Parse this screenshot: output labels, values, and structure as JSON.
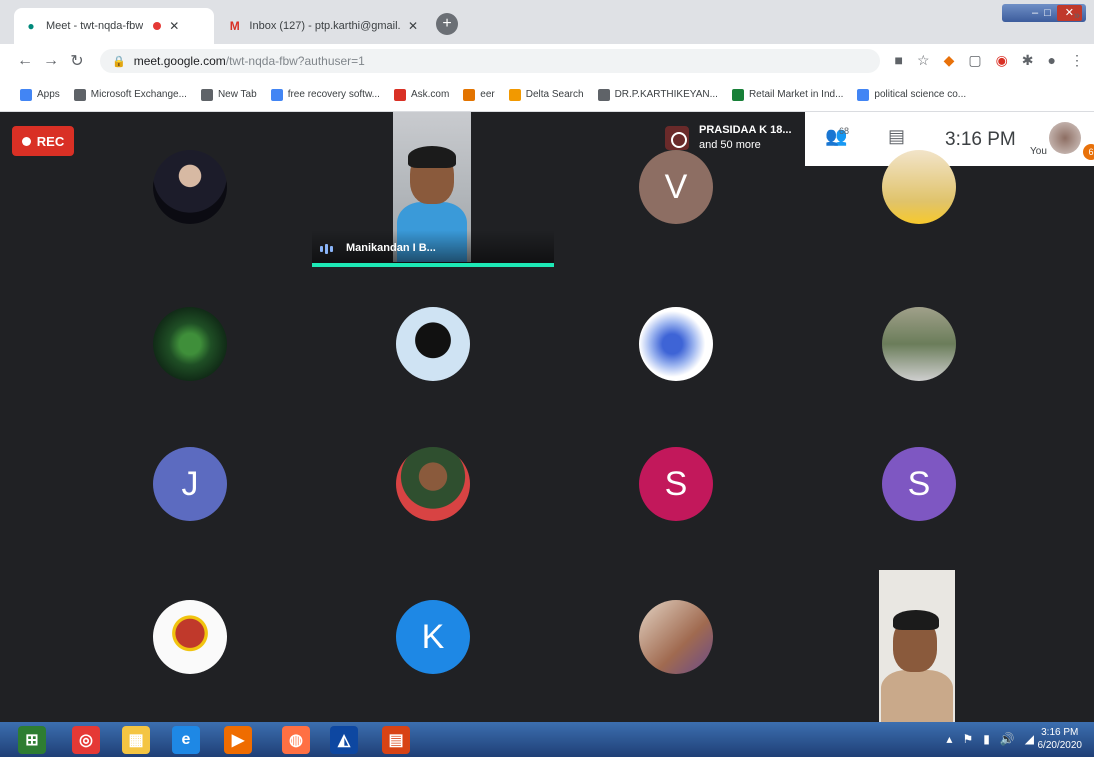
{
  "browser": {
    "tabs": [
      {
        "title": "Meet - twt-nqda-fbw",
        "active": true,
        "icon": "meet-icon",
        "recording": true
      },
      {
        "title": "Inbox (127) - ptp.karthi@gmail...",
        "active": false,
        "icon": "gmail-icon"
      }
    ],
    "new_tab": "+",
    "url_host": "meet.google.com",
    "url_path": "/twt-nqda-fbw?authuser=1",
    "bookmarks": [
      {
        "label": "Apps",
        "icon": "apps-icon",
        "color": "#4285f4"
      },
      {
        "label": "Microsoft Exchange...",
        "icon": "globe-icon",
        "color": "#5f6368"
      },
      {
        "label": "New Tab",
        "icon": "globe-icon",
        "color": "#5f6368"
      },
      {
        "label": "free recovery softw...",
        "icon": "google-icon",
        "color": "#4285f4"
      },
      {
        "label": "Ask.com",
        "icon": "ask-icon",
        "color": "#d93025"
      },
      {
        "label": "eer",
        "icon": "bookmark-icon",
        "color": "#e37400"
      },
      {
        "label": "Delta Search",
        "icon": "delta-icon",
        "color": "#f29900"
      },
      {
        "label": "DR.P.KARTHIKEYAN...",
        "icon": "globe-icon",
        "color": "#5f6368"
      },
      {
        "label": "Retail Market in Ind...",
        "icon": "bookmark-icon",
        "color": "#188038"
      },
      {
        "label": "political science co...",
        "icon": "google-icon",
        "color": "#4285f4"
      }
    ],
    "more_bookmarks": "»"
  },
  "meet": {
    "rec_label": "REC",
    "speaker_name": "Manikandan I B...",
    "presenter": {
      "name": "PRASIDAA K 18...",
      "more": "and 50 more"
    },
    "people_count": "68",
    "time": "3:16 PM",
    "you_label": "You",
    "notification_count": "6",
    "participants": [
      {
        "kind": "photo",
        "name": "participant-photo-1",
        "bg": "radial-gradient(circle at 50% 35%, #d7b9a3 0 18%, #1c1c2a 19% 60%, #0b0b12 61%)"
      },
      {
        "kind": "letter",
        "letter": "V",
        "color": "#8d6e63"
      },
      {
        "kind": "photo",
        "name": "participant-photo-2",
        "bg": "linear-gradient(#f2e4c9, #e0c36a 70%, #f7c92c)"
      },
      {
        "kind": "photo",
        "name": "participant-photo-3",
        "bg": "radial-gradient(circle, #3f8f3a 0 20%, #1f4f25 40%, #0c1f12 80%)"
      },
      {
        "kind": "photo",
        "name": "participant-photo-4",
        "bg": "radial-gradient(circle at 50% 45%, #111 0 32%, #cfe3f3 33%)"
      },
      {
        "kind": "photo",
        "name": "participant-photo-5",
        "bg": "radial-gradient(circle at 45% 50%, #3e64d6 0 18%, #9fb7f0 40%, #ffffff 60%)"
      },
      {
        "kind": "photo",
        "name": "participant-photo-6",
        "bg": "linear-gradient(#a0a08a, #6b7d5a 50%, #cfcfcf)"
      },
      {
        "kind": "letter",
        "letter": "J",
        "color": "#5c6bc0"
      },
      {
        "kind": "photo",
        "name": "participant-photo-7",
        "bg": "radial-gradient(circle at 50% 40%, #8a5a3c 0 24%, #2f4f2f 25% 55%, #d84343 56%)"
      },
      {
        "kind": "letter",
        "letter": "S",
        "color": "#c2185b"
      },
      {
        "kind": "letter",
        "letter": "S",
        "color": "#7e57c2"
      },
      {
        "kind": "photo",
        "name": "participant-photo-8",
        "bg": "radial-gradient(circle at 50% 45%, #c0392b 0 26%, #f1c40f 27% 32%, #fafafa 33%)"
      },
      {
        "kind": "letter",
        "letter": "K",
        "color": "#1e88e5"
      },
      {
        "kind": "photo",
        "name": "participant-photo-9",
        "bg": "linear-gradient(135deg, #e3d3c3, #a06a50 60%, #6a4a8a)"
      }
    ]
  },
  "taskbar": {
    "tray_time": "3:16 PM",
    "tray_date": "6/20/2020",
    "apps": [
      {
        "name": "start-orb",
        "color": "#2e7d32"
      },
      {
        "name": "chrome-app",
        "color": "#e53935"
      },
      {
        "name": "explorer-app",
        "color": "#f4c542"
      },
      {
        "name": "ie-app",
        "color": "#1e88e5"
      },
      {
        "name": "media-app",
        "color": "#ef6c00"
      },
      {
        "name": "outlook-app",
        "color": "#1565c0"
      },
      {
        "name": "firefox-app",
        "color": "#ff7043"
      },
      {
        "name": "vlc-app",
        "color": "#0d47a1"
      },
      {
        "name": "powerpoint-app",
        "color": "#d84315"
      }
    ]
  }
}
